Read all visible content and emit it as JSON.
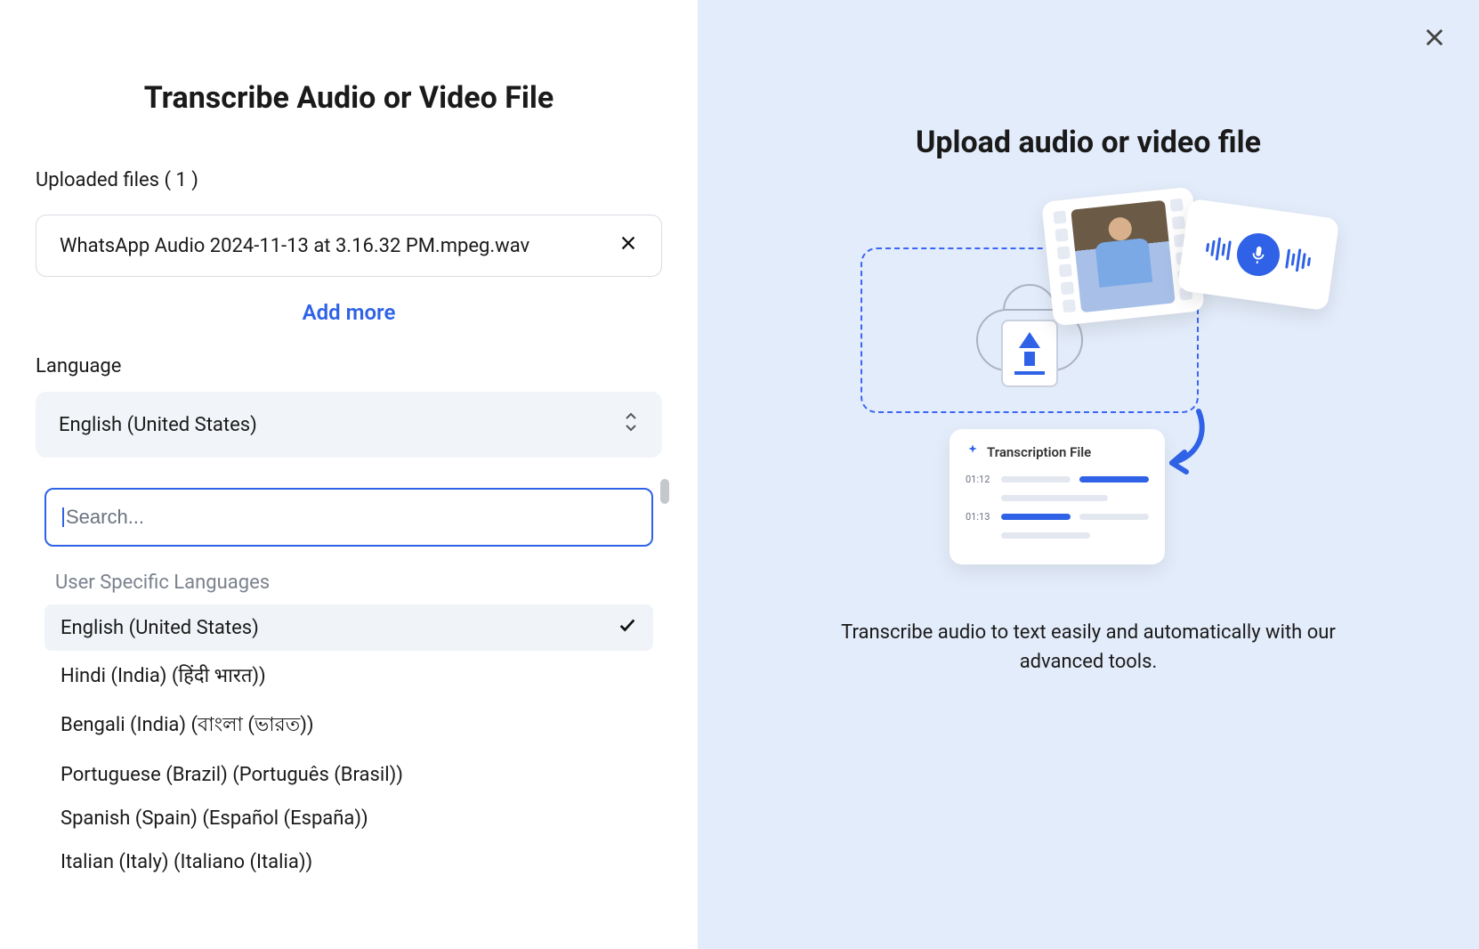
{
  "left": {
    "title": "Transcribe Audio or Video File",
    "uploaded_label": "Uploaded files ( 1 )",
    "file_name": "WhatsApp Audio 2024-11-13 at 3.16.32 PM.mpeg.wav",
    "add_more": "Add more",
    "language_label": "Language",
    "selected_language": "English (United States)",
    "search_placeholder": "Search...",
    "section_header": "User Specific Languages",
    "options": [
      {
        "label": "English (United States)",
        "selected": true
      },
      {
        "label": "Hindi (India) (हिंदी भारत))",
        "selected": false
      },
      {
        "label": "Bengali (India) (বাংলা (ভারত))",
        "selected": false
      },
      {
        "label": "Portuguese (Brazil) (Português (Brasil))",
        "selected": false
      },
      {
        "label": "Spanish (Spain) (Español (España))",
        "selected": false
      },
      {
        "label": "Italian (Italy) (Italiano (Italia))",
        "selected": false
      }
    ]
  },
  "right": {
    "title": "Upload audio or video file",
    "description": "Transcribe audio to text easily and automatically with our advanced tools.",
    "transcript_title": "Transcription File",
    "timestamps": [
      "01:12",
      "01:13"
    ]
  }
}
